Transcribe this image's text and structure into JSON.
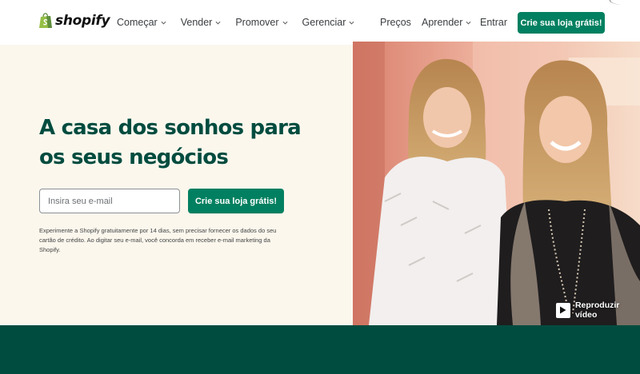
{
  "header": {
    "logo_text": "shopify",
    "nav_left": [
      {
        "label": "Começar"
      },
      {
        "label": "Vender"
      },
      {
        "label": "Promover"
      },
      {
        "label": "Gerenciar"
      }
    ],
    "nav_right": {
      "pricing": "Preços",
      "learn": "Aprender",
      "login": "Entrar",
      "cta": "Crie sua loja grátis!"
    }
  },
  "hero": {
    "title": "A casa dos sonhos para os seus negócios",
    "email_placeholder": "Insira seu e-mail",
    "email_value": "",
    "cta": "Crie sua loja grátis!",
    "disclaimer": "Experimente a Shopify gratuitamente por 14 dias, sem precisar fornecer os dados do seu cartão de crédito. Ao digitar seu e-mail, você concorda em receber e-mail marketing da Shopify."
  },
  "video": {
    "play_label": "Reproduzir vídeo"
  },
  "colors": {
    "brand_green": "#008060",
    "dark_green": "#004c3f",
    "hero_bg": "#fbf7ed"
  },
  "icons": [
    "shopify-bag-icon",
    "chevron-down-icon",
    "play-icon"
  ]
}
